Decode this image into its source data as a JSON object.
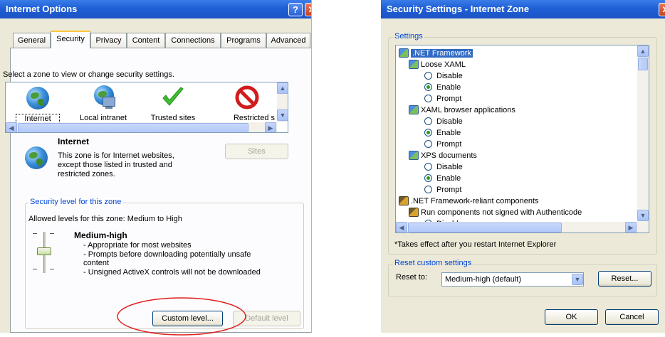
{
  "internet_options": {
    "title": "Internet Options",
    "help_btn": "?",
    "tabs": [
      "General",
      "Security",
      "Privacy",
      "Content",
      "Connections",
      "Programs",
      "Advanced"
    ],
    "select_zone_label": "Select a zone to view or change security settings.",
    "zones": [
      {
        "label": "Internet",
        "icon": "globe-icon"
      },
      {
        "label": "Local intranet",
        "icon": "intranet-icon"
      },
      {
        "label": "Trusted sites",
        "icon": "check-icon"
      },
      {
        "label": "Restricted s",
        "icon": "restricted-icon"
      }
    ],
    "zone_title": "Internet",
    "zone_desc_1": "This zone is for Internet websites,",
    "zone_desc_2": "except those listed in trusted and",
    "zone_desc_3": "restricted zones.",
    "sites_btn": "Sites",
    "security_group_legend": "Security level for this zone",
    "allowed_levels": "Allowed levels for this zone: Medium to High",
    "level_name": "Medium-high",
    "level_items": [
      "- Appropriate for most websites",
      "- Prompts before downloading potentially unsafe",
      "content",
      "- Unsigned ActiveX controls will not be downloaded"
    ],
    "custom_level_btn": "Custom level...",
    "default_level_btn": "Default level"
  },
  "security_settings": {
    "title": "Security Settings - Internet Zone",
    "settings_legend": "Settings",
    "tree": [
      {
        "text": ".NET Framework",
        "icon": "ie-settings-icon"
      },
      {
        "text": "Loose XAML",
        "icon": "ie-settings-icon"
      },
      {
        "text": "Disable",
        "radio": false
      },
      {
        "text": "Enable",
        "radio": true
      },
      {
        "text": "Prompt",
        "radio": false
      },
      {
        "text": "XAML browser applications",
        "icon": "ie-settings-icon"
      },
      {
        "text": "Disable",
        "radio": false
      },
      {
        "text": "Enable",
        "radio": true
      },
      {
        "text": "Prompt",
        "radio": false
      },
      {
        "text": "XPS documents",
        "icon": "ie-settings-icon"
      },
      {
        "text": "Disable",
        "radio": false
      },
      {
        "text": "Enable",
        "radio": true
      },
      {
        "text": "Prompt",
        "radio": false
      },
      {
        "text": ".NET Framework-reliant components",
        "icon": "component-icon"
      },
      {
        "text": "Run components not signed with Authenticode",
        "icon": "component-icon"
      },
      {
        "text": "Disable",
        "radio": false
      }
    ],
    "note": "*Takes effect after you restart Internet Explorer",
    "reset_legend": "Reset custom settings",
    "reset_to_label": "Reset to:",
    "reset_value": "Medium-high (default)",
    "reset_btn": "Reset...",
    "ok_btn": "OK",
    "cancel_btn": "Cancel"
  },
  "annotation": {
    "color": "#e02020",
    "shape": "ellipse"
  }
}
